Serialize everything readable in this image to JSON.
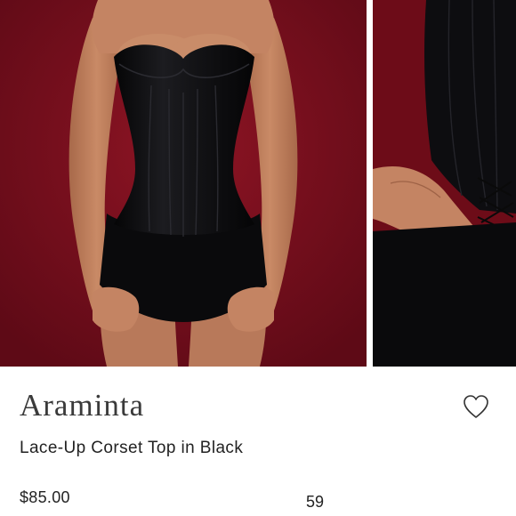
{
  "listing": {
    "brand": "Araminta",
    "title": "Lace-Up Corset Top in Black",
    "price": "$85.00",
    "like_count": "59"
  },
  "icons": {
    "like": "heart-outline-icon"
  },
  "colors": {
    "photo_background": "#7a0f1d",
    "garment": "#0c0c0e",
    "text_primary": "#222222",
    "brand_text": "#3a3a3a"
  }
}
